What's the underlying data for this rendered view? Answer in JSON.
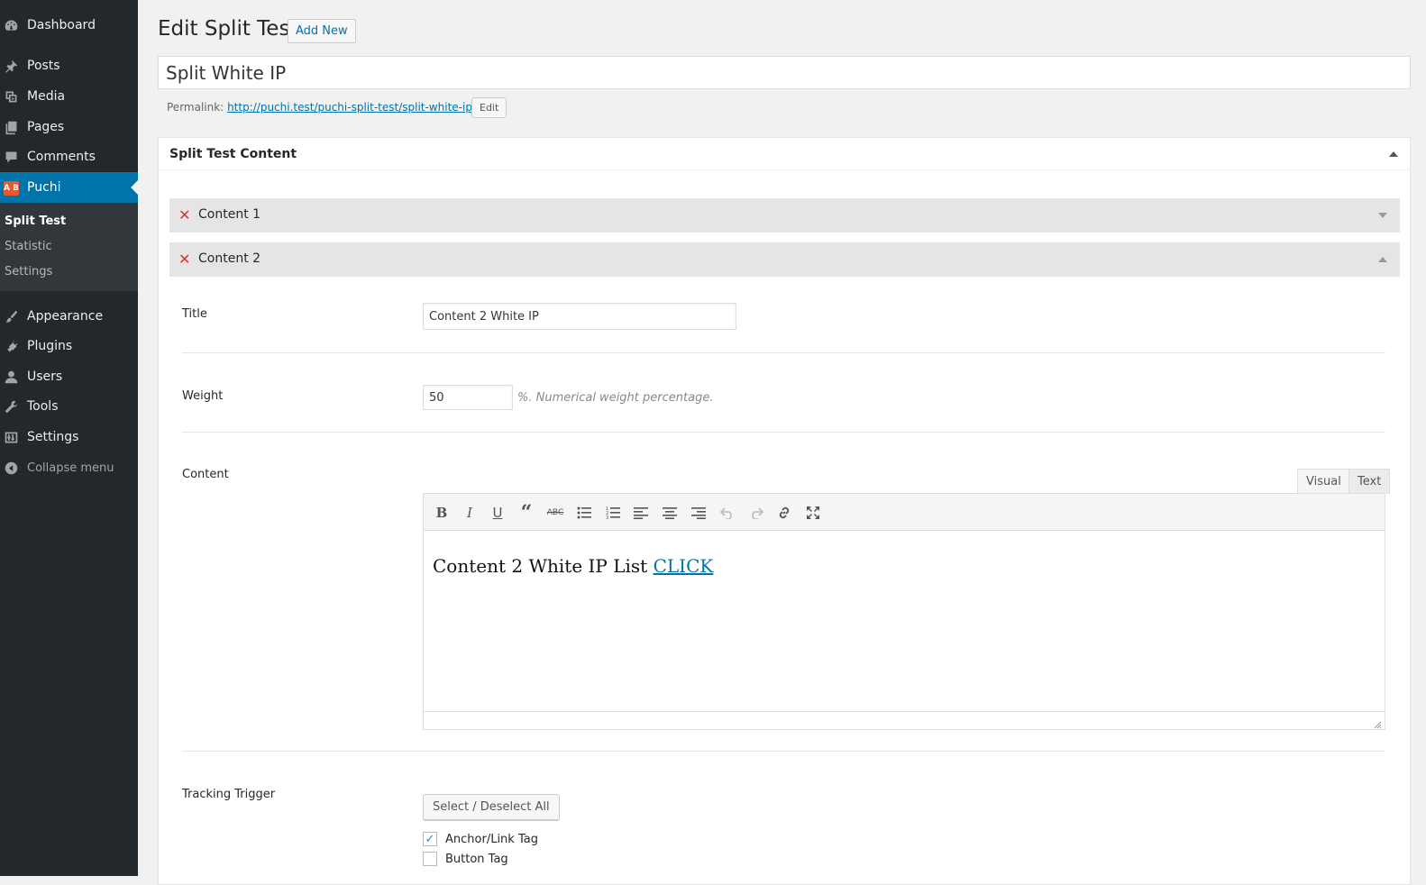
{
  "sidebar": {
    "dashboard": "Dashboard",
    "posts": "Posts",
    "media": "Media",
    "pages": "Pages",
    "comments": "Comments",
    "puchi": "Puchi",
    "puchi_badge": "A B",
    "sub_split_test": "Split Test",
    "sub_statistic": "Statistic",
    "sub_settings": "Settings",
    "appearance": "Appearance",
    "plugins": "Plugins",
    "users": "Users",
    "tools": "Tools",
    "settings": "Settings",
    "collapse": "Collapse menu"
  },
  "header": {
    "title": "Edit Split Test",
    "add_new": "Add New"
  },
  "post": {
    "title_value": "Split White IP",
    "permalink_label": "Permalink:",
    "permalink_url": "http://puchi.test/puchi-split-test/split-white-ip/",
    "permalink_edit": "Edit"
  },
  "metabox": {
    "title": "Split Test Content",
    "content1_label": "Content 1",
    "content2_label": "Content 2",
    "fields": {
      "title_label": "Title",
      "title_value": "Content 2 White IP",
      "weight_label": "Weight",
      "weight_value": "50",
      "weight_desc": "%. Numerical weight percentage.",
      "content_label": "Content",
      "tab_visual": "Visual",
      "tab_text": "Text",
      "editor_text": "Content 2 White IP List ",
      "editor_link": "CLICK",
      "tracking_label": "Tracking Trigger",
      "select_all": "Select / Deselect All",
      "triggers": [
        {
          "label": "Anchor/Link Tag",
          "checked": true
        },
        {
          "label": "Button Tag",
          "checked": false
        }
      ]
    }
  },
  "colors": {
    "sidebar_bg": "#23282d",
    "accent": "#0073aa",
    "delete": "#dc3232"
  }
}
